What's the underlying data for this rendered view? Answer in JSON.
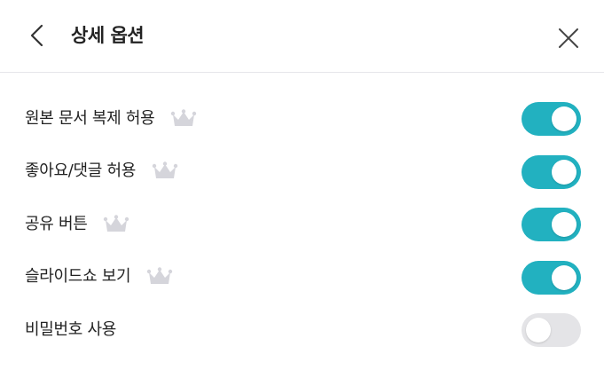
{
  "header": {
    "title": "상세 옵션",
    "back_icon": "chevron-left-icon",
    "close_icon": "close-icon"
  },
  "colors": {
    "toggle_on": "#22b1c0",
    "toggle_off": "#e4e4e7",
    "crown": "#d5d5db",
    "icon": "#333333"
  },
  "options": [
    {
      "label": "원본 문서 복제 허용",
      "premium": true,
      "enabled": true
    },
    {
      "label": "좋아요/댓글 허용",
      "premium": true,
      "enabled": true
    },
    {
      "label": "공유 버튼",
      "premium": true,
      "enabled": true
    },
    {
      "label": "슬라이드쇼 보기",
      "premium": true,
      "enabled": true
    },
    {
      "label": "비밀번호 사용",
      "premium": false,
      "enabled": false
    }
  ]
}
